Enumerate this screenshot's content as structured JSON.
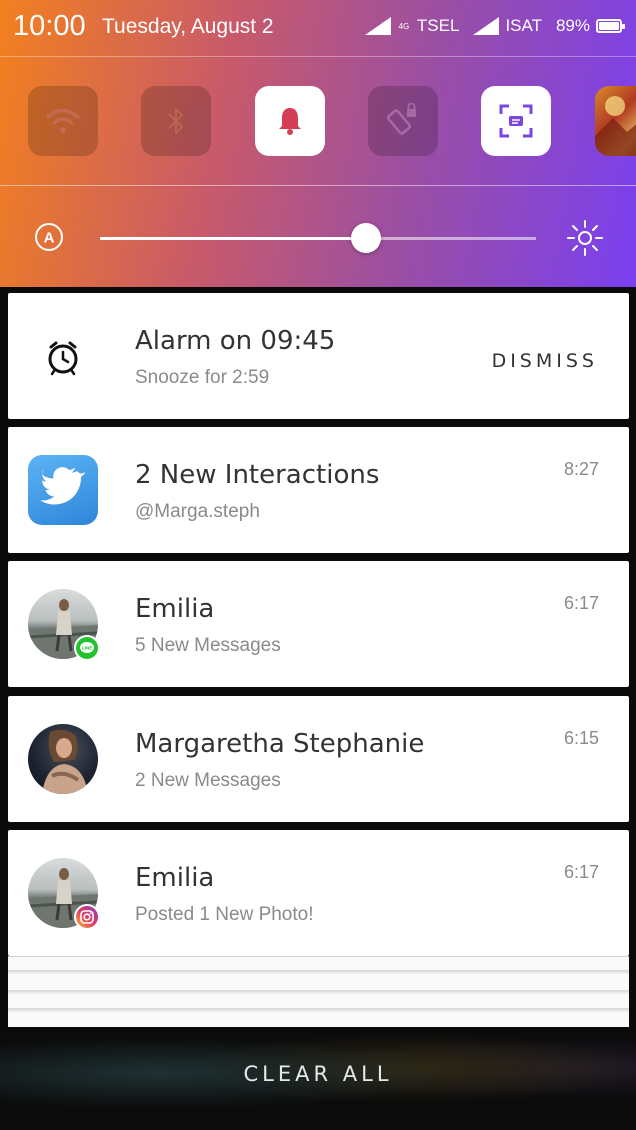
{
  "status_bar": {
    "time": "10:00",
    "date": "Tuesday, August 2",
    "network_type": "4G",
    "carrier1": "TSEL",
    "carrier2": "ISAT",
    "battery": "89%"
  },
  "quick_settings": {
    "tiles": [
      {
        "icon": "wifi-icon",
        "active": false
      },
      {
        "icon": "bluetooth-icon",
        "active": false
      },
      {
        "icon": "bell-icon",
        "active": true
      },
      {
        "icon": "rotation-lock-icon",
        "active": false
      },
      {
        "icon": "screenshot-icon",
        "active": true
      },
      {
        "icon": "thumbnail-image",
        "active": false
      }
    ],
    "brightness": {
      "auto_label": "A",
      "level": 0.61
    }
  },
  "notifications": [
    {
      "type": "alarm",
      "icon": "alarm-clock-icon",
      "title": "Alarm on 09:45",
      "subtitle": "Snooze for 2:59",
      "action": "DISMISS"
    },
    {
      "type": "twitter",
      "icon": "twitter-icon",
      "title": "2 New Interactions",
      "subtitle": "@Marga.steph",
      "time": "8:27"
    },
    {
      "type": "line",
      "icon": "avatar-emilia",
      "badge": "line-icon",
      "title": "Emilia",
      "subtitle": "5 New Messages",
      "time": "6:17"
    },
    {
      "type": "message",
      "icon": "avatar-margaretha",
      "title": "Margaretha Stephanie",
      "subtitle": "2 New Messages",
      "time": "6:15"
    },
    {
      "type": "instagram",
      "icon": "avatar-emilia",
      "badge": "instagram-icon",
      "title": "Emilia",
      "subtitle": "Posted 1 New Photo!",
      "time": "6:17"
    }
  ],
  "clear_all": "CLEAR ALL",
  "colors": {
    "gradient_start": "#f2801e",
    "gradient_end": "#7a3ff0",
    "twitter_blue": "#3d9be9",
    "line_green": "#22c32e"
  }
}
